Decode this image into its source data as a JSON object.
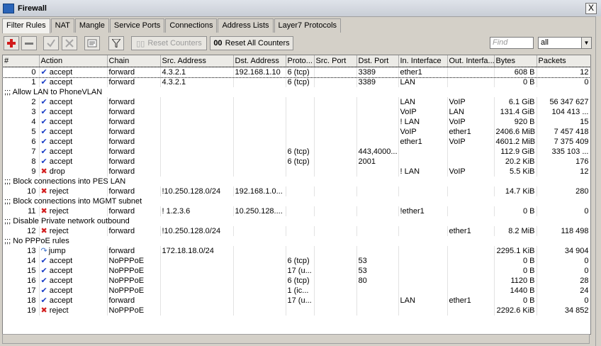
{
  "window": {
    "title": "Firewall",
    "close_label": "X"
  },
  "tabs": [
    "Filter Rules",
    "NAT",
    "Mangle",
    "Service Ports",
    "Connections",
    "Address Lists",
    "Layer7 Protocols"
  ],
  "toolbar": {
    "add_icon": "plus-icon",
    "remove_icon": "minus-icon",
    "enable_icon": "check-icon",
    "disable_icon": "cross-icon",
    "comment_icon": "comment-icon",
    "filter_icon": "filter-icon",
    "reset_counters": "Reset Counters",
    "reset_all_prefix": "00",
    "reset_all_counters": "Reset All Counters",
    "find_placeholder": "Find",
    "select_value": "all"
  },
  "columns": [
    "#",
    "Action",
    "Chain",
    "Src. Address",
    "Dst. Address",
    "Proto...",
    "Src. Port",
    "Dst. Port",
    "In. Interface",
    "Out. Interfa...",
    "Bytes",
    "Packets"
  ],
  "rows": [
    {
      "type": "rule",
      "num": "0",
      "action": "accept",
      "icon": "check",
      "chain": "forward",
      "src": "4.3.2.1",
      "dst": "192.168.1.10",
      "proto": "6 (tcp)",
      "sport": "",
      "dport": "3389",
      "inif": "ether1",
      "outif": "",
      "bytes": "608 B",
      "packets": "12",
      "selected": true
    },
    {
      "type": "rule",
      "num": "1",
      "action": "accept",
      "icon": "check",
      "chain": "forward",
      "src": "4.3.2.1",
      "dst": "",
      "proto": "6 (tcp)",
      "sport": "",
      "dport": "3389",
      "inif": "LAN",
      "outif": "",
      "bytes": "0 B",
      "packets": "0"
    },
    {
      "type": "comment",
      "text": ";;; Allow LAN to PhoneVLAN"
    },
    {
      "type": "rule",
      "num": "2",
      "action": "accept",
      "icon": "check",
      "chain": "forward",
      "src": "",
      "dst": "",
      "proto": "",
      "sport": "",
      "dport": "",
      "inif": "LAN",
      "outif": "VoIP",
      "bytes": "6.1 GiB",
      "packets": "56 347 627"
    },
    {
      "type": "rule",
      "num": "3",
      "action": "accept",
      "icon": "check",
      "chain": "forward",
      "src": "",
      "dst": "",
      "proto": "",
      "sport": "",
      "dport": "",
      "inif": "VoIP",
      "outif": "LAN",
      "bytes": "131.4 GiB",
      "packets": "104 413 ..."
    },
    {
      "type": "rule",
      "num": "4",
      "action": "accept",
      "icon": "check",
      "chain": "forward",
      "src": "",
      "dst": "",
      "proto": "",
      "sport": "",
      "dport": "",
      "inif": "! LAN",
      "outif": "VoIP",
      "bytes": "920 B",
      "packets": "15"
    },
    {
      "type": "rule",
      "num": "5",
      "action": "accept",
      "icon": "check",
      "chain": "forward",
      "src": "",
      "dst": "",
      "proto": "",
      "sport": "",
      "dport": "",
      "inif": "VoIP",
      "outif": "ether1",
      "bytes": "2406.6 MiB",
      "packets": "7 457 418"
    },
    {
      "type": "rule",
      "num": "6",
      "action": "accept",
      "icon": "check",
      "chain": "forward",
      "src": "",
      "dst": "",
      "proto": "",
      "sport": "",
      "dport": "",
      "inif": "ether1",
      "outif": "VoIP",
      "bytes": "4601.2 MiB",
      "packets": "7 375 409"
    },
    {
      "type": "rule",
      "num": "7",
      "action": "accept",
      "icon": "check",
      "chain": "forward",
      "src": "",
      "dst": "",
      "proto": "6 (tcp)",
      "sport": "",
      "dport": "443,4000...",
      "inif": "",
      "outif": "",
      "bytes": "112.9 GiB",
      "packets": "335 103 ..."
    },
    {
      "type": "rule",
      "num": "8",
      "action": "accept",
      "icon": "check",
      "chain": "forward",
      "src": "",
      "dst": "",
      "proto": "6 (tcp)",
      "sport": "",
      "dport": "2001",
      "inif": "",
      "outif": "",
      "bytes": "20.2 KiB",
      "packets": "176"
    },
    {
      "type": "rule",
      "num": "9",
      "action": "drop",
      "icon": "x",
      "chain": "forward",
      "src": "",
      "dst": "",
      "proto": "",
      "sport": "",
      "dport": "",
      "inif": "! LAN",
      "outif": "VoIP",
      "bytes": "5.5 KiB",
      "packets": "12"
    },
    {
      "type": "comment",
      "text": ";;; Block connections into PES LAN"
    },
    {
      "type": "rule",
      "num": "10",
      "action": "reject",
      "icon": "x",
      "chain": "forward",
      "src": "!10.250.128.0/24",
      "dst": "192.168.1.0...",
      "proto": "",
      "sport": "",
      "dport": "",
      "inif": "",
      "outif": "",
      "bytes": "14.7 KiB",
      "packets": "280"
    },
    {
      "type": "comment",
      "text": ";;; Block connections into MGMT subnet"
    },
    {
      "type": "rule",
      "num": "11",
      "action": "reject",
      "icon": "x",
      "chain": "forward",
      "src": "! 1.2.3.6",
      "dst": "10.250.128....",
      "proto": "",
      "sport": "",
      "dport": "",
      "inif": "!ether1",
      "outif": "",
      "bytes": "0 B",
      "packets": "0"
    },
    {
      "type": "comment",
      "text": ";;; Disable Private network outbound"
    },
    {
      "type": "rule",
      "num": "12",
      "action": "reject",
      "icon": "x",
      "chain": "forward",
      "src": "!10.250.128.0/24",
      "dst": "",
      "proto": "",
      "sport": "",
      "dport": "",
      "inif": "",
      "outif": "ether1",
      "bytes": "8.2 MiB",
      "packets": "118 498"
    },
    {
      "type": "comment",
      "text": ";;; No PPPoE rules"
    },
    {
      "type": "rule",
      "num": "13",
      "action": "jump",
      "icon": "jump",
      "chain": "forward",
      "src": "172.18.18.0/24",
      "dst": "",
      "proto": "",
      "sport": "",
      "dport": "",
      "inif": "",
      "outif": "",
      "bytes": "2295.1 KiB",
      "packets": "34 904"
    },
    {
      "type": "rule",
      "num": "14",
      "action": "accept",
      "icon": "check",
      "chain": "NoPPPoE",
      "src": "",
      "dst": "",
      "proto": "6 (tcp)",
      "sport": "",
      "dport": "53",
      "inif": "",
      "outif": "",
      "bytes": "0 B",
      "packets": "0"
    },
    {
      "type": "rule",
      "num": "15",
      "action": "accept",
      "icon": "check",
      "chain": "NoPPPoE",
      "src": "",
      "dst": "",
      "proto": "17 (u...",
      "sport": "",
      "dport": "53",
      "inif": "",
      "outif": "",
      "bytes": "0 B",
      "packets": "0"
    },
    {
      "type": "rule",
      "num": "16",
      "action": "accept",
      "icon": "check",
      "chain": "NoPPPoE",
      "src": "",
      "dst": "",
      "proto": "6 (tcp)",
      "sport": "",
      "dport": "80",
      "inif": "",
      "outif": "",
      "bytes": "1120 B",
      "packets": "28"
    },
    {
      "type": "rule",
      "num": "17",
      "action": "accept",
      "icon": "check",
      "chain": "NoPPPoE",
      "src": "",
      "dst": "",
      "proto": "1 (ic...",
      "sport": "",
      "dport": "",
      "inif": "",
      "outif": "",
      "bytes": "1440 B",
      "packets": "24"
    },
    {
      "type": "rule",
      "num": "18",
      "action": "accept",
      "icon": "check",
      "chain": "forward",
      "src": "",
      "dst": "",
      "proto": "17 (u...",
      "sport": "",
      "dport": "",
      "inif": "LAN",
      "outif": "ether1",
      "bytes": "0 B",
      "packets": "0"
    },
    {
      "type": "rule",
      "num": "19",
      "action": "reject",
      "icon": "x",
      "chain": "NoPPPoE",
      "src": "",
      "dst": "",
      "proto": "",
      "sport": "",
      "dport": "",
      "inif": "",
      "outif": "",
      "bytes": "2292.6 KiB",
      "packets": "34 852"
    }
  ]
}
